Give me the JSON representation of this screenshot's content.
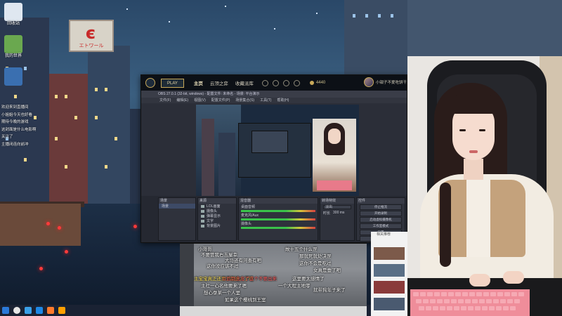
{
  "wallpaper": {
    "sign_logo": "є",
    "sign_text": "エトワール"
  },
  "desktop_icons": [
    {
      "label": "回收站",
      "color": "#dfe7f0"
    },
    {
      "label": "我的世界",
      "color": "#6aa84f"
    },
    {
      "label": "",
      "color": "#3a6fb0"
    }
  ],
  "chat": {
    "lines": [
      "欢迎来到直播间",
      "小姐姐今天也好看",
      "期待今晚的游戏",
      "这封面是什么电影啊",
      "关注了",
      "主播闭连向前冲"
    ]
  },
  "game_client": {
    "play_label": "PLAY",
    "nav": [
      "主页",
      "云顶之弈",
      "收藏派库"
    ],
    "rp": "4440",
    "username": "小钳子不爱吃饼干"
  },
  "obs": {
    "title": "OBS 27.0.1 (32-bit, windows) - 配置文件: 未命名 - 场景: 平台演示",
    "menu": [
      "文件(F)",
      "编辑(E)",
      "视图(V)",
      "配置文件(P)",
      "场景集合(S)",
      "工具(T)",
      "帮助(H)"
    ],
    "docks": {
      "scenes": "场景",
      "sources": "来源",
      "mixer": "混音器",
      "transitions": "转场特效",
      "controls": "控件"
    },
    "scene_items": [
      "场景"
    ],
    "source_items": [
      "LOL画面",
      "摄像头",
      "弹幕显示",
      "文字",
      "背景图片"
    ],
    "mixer_items": [
      "桌面音频",
      "麦克风/Aux",
      "摄像头"
    ],
    "transition": {
      "type": "淡出",
      "duration_label": "时长",
      "duration": "300 ms"
    },
    "controls": [
      "停止推流",
      "开始录制",
      "启动虚拟摄像机",
      "工作室模式",
      "设置",
      "退出"
    ]
  },
  "video": {
    "danmaku": [
      {
        "text": "小哥哥",
        "color": "white"
      },
      {
        "text": "不要管我右吉屋幸",
        "color": "white"
      },
      {
        "text": "故十五个什么罡",
        "color": "white"
      },
      {
        "text": "这你没应该不过",
        "color": "white"
      },
      {
        "text": "那就死就处决罡",
        "color": "white"
      },
      {
        "text": "大马还有问查有吧",
        "color": "white"
      },
      {
        "text": "这你不会是吃过",
        "color": "white"
      },
      {
        "text": "女真是壹了吧",
        "color": "white"
      },
      {
        "text": "主宝宝真正还要子就进入了吗",
        "color": "yellow"
      },
      {
        "text": "这里要太感情了",
        "color": "white"
      },
      {
        "text": "以后别念念了这个不要出来",
        "color": "red"
      },
      {
        "text": "一个大程主地零",
        "color": "white"
      },
      {
        "text": "主社一心名他要来了嗯",
        "color": "white"
      },
      {
        "text": "就带狗年子来了",
        "color": "white"
      },
      {
        "text": "想心沗某一个人里",
        "color": "white"
      },
      {
        "text": "如果这个樱桃到王室",
        "color": "white"
      }
    ]
  },
  "thumbs": {
    "header": "相关推荐",
    "count": 4
  },
  "taskbar": {
    "icons": [
      "#2b79d8",
      "#e5e5e5",
      "#3aa0e8",
      "#1e88e5",
      "#ff7a2b",
      "#ffa000"
    ]
  }
}
